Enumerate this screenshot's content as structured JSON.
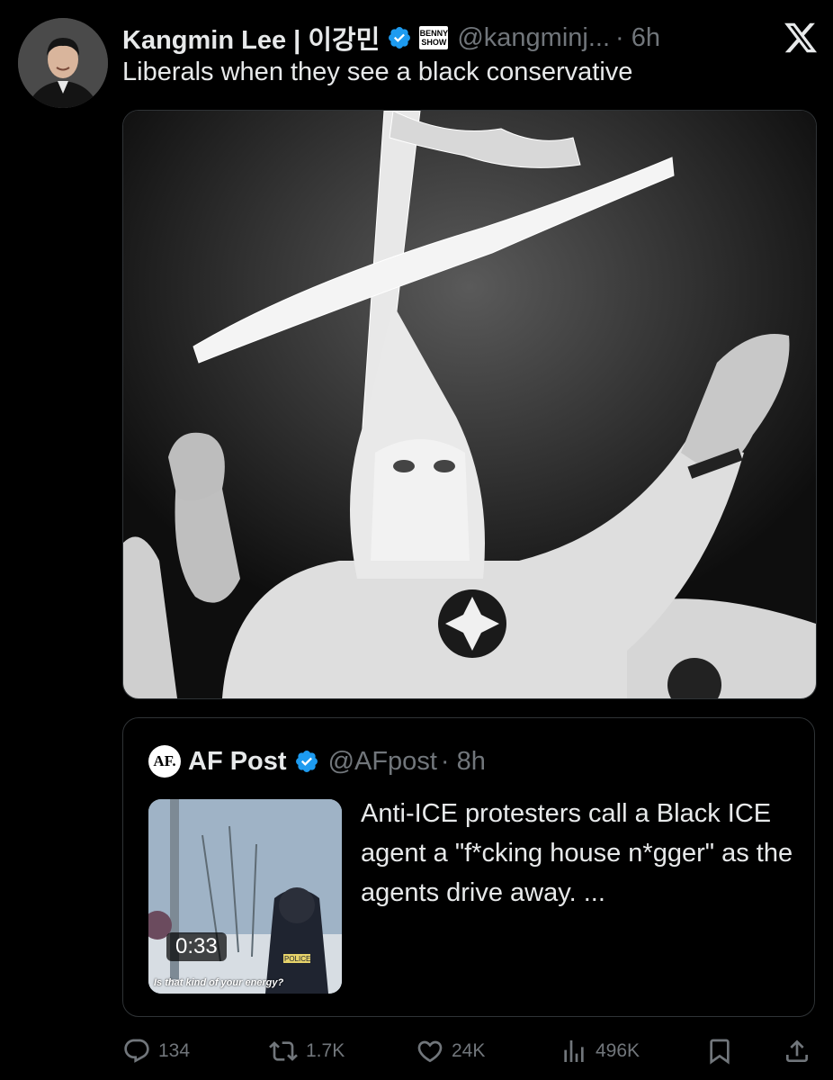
{
  "author": {
    "name": "Kangmin Lee | 이강민",
    "handle": "@kangminj...",
    "time": "· 6h",
    "badge_text_line1": "BENNY",
    "badge_text_line2": "SHOW"
  },
  "tweet": {
    "text": "Liberals when they see a black conservative"
  },
  "quote": {
    "logo_text": "AF.",
    "name": "AF Post",
    "handle": "@AFpost",
    "time": "· 8h",
    "text": "Anti-ICE protesters call a Black ICE agent a \"f*cking house n*gger\" as the agents drive away. ...",
    "video_duration": "0:33",
    "video_caption": "Is that kind of your energy?",
    "vest_text": "POLICE"
  },
  "actions": {
    "replies": "134",
    "reposts": "1.7K",
    "likes": "24K",
    "views": "496K"
  },
  "colors": {
    "background": "#000000",
    "text": "#e7e9ea",
    "muted": "#71767b",
    "verified": "#1d9bf0",
    "border": "#2f3336"
  }
}
